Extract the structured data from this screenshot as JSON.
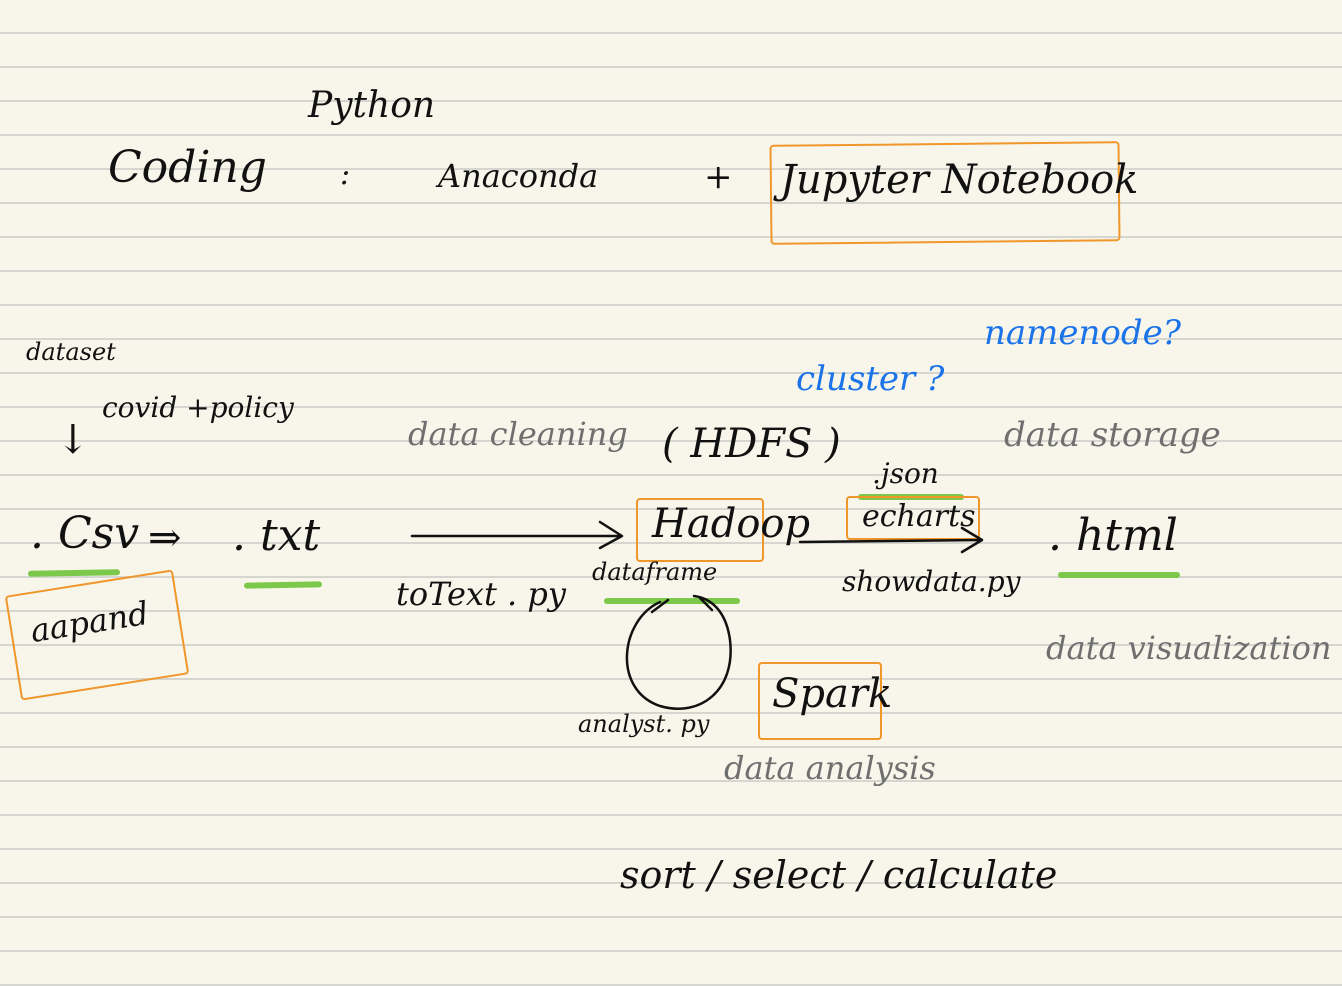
{
  "header": {
    "python": "Python",
    "coding": "Coding",
    "colon": ":",
    "anaconda": "Anaconda",
    "plus": "+",
    "jupyter": "Jupyter Notebook"
  },
  "left": {
    "dataset": "dataset",
    "topic": "covid +policy",
    "down_arrow": "↓",
    "csv": ". Csv",
    "arrow": "⇒",
    "txt": ". txt",
    "append": "aapand"
  },
  "middle": {
    "cleaning": "data cleaning",
    "hdfs": "( HDFS )",
    "to_text": "toText . py",
    "hadoop": "Hadoop",
    "dataframe": "dataframe",
    "analyse": "analyst. py",
    "spark": "Spark",
    "analysis": "data analysis",
    "ops": "sort / select / calculate"
  },
  "right": {
    "cluster": "cluster ?",
    "namenode": "namenode?",
    "storage": "data storage",
    "json": ".json",
    "echarts": "echarts",
    "showdata": "showdata.py",
    "html": ". html",
    "visualization": "data visualization"
  },
  "colors": {
    "paper": "#f8f6ea",
    "rule": "#d6d6d0",
    "ink": "#111111",
    "pencil": "#6f6f6f",
    "note_blue": "#1a73e8",
    "highlight_orange": "#f0962a",
    "highlight_green": "#7cc84a"
  }
}
